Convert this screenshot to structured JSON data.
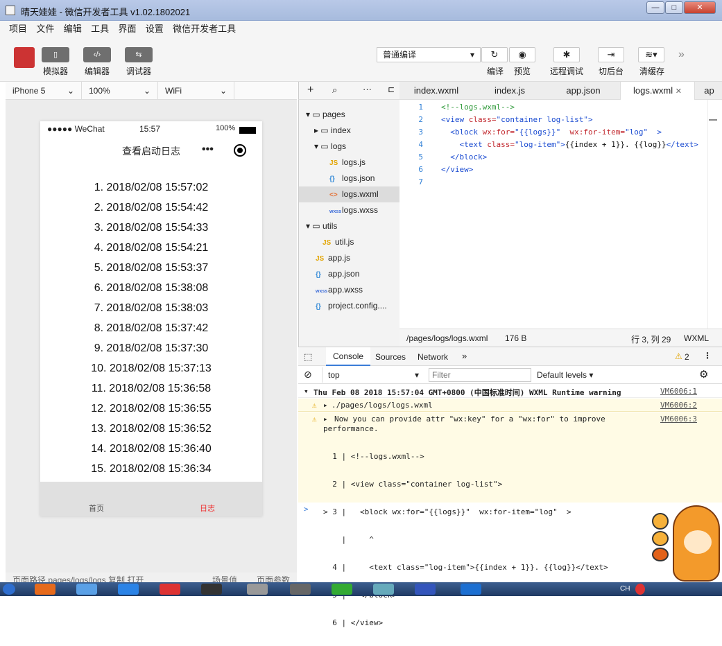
{
  "window": {
    "title": "晴天娃娃 - 微信开发者工具 v1.02.1802021",
    "btn_min": "—",
    "btn_max": "□",
    "btn_close": "✕"
  },
  "menu": [
    "项目",
    "文件",
    "编辑",
    "工具",
    "界面",
    "设置",
    "微信开发者工具"
  ],
  "toolbar": {
    "simulator": "模拟器",
    "editor": "编辑器",
    "debugger": "调试器",
    "compile_mode": "普通编译",
    "compile": "编译",
    "preview": "预览",
    "remote_debug": "远程调试",
    "background": "切后台",
    "clear_cache": "清缓存"
  },
  "simulator": {
    "device": "iPhone 5",
    "zoom": "100%",
    "network": "WiFi",
    "status_left": "●●●●● WeChat",
    "status_time": "15:57",
    "status_battery": "100%",
    "nav_title": "查看启动日志",
    "logs": [
      "1. 2018/02/08 15:57:02",
      "2. 2018/02/08 15:54:42",
      "3. 2018/02/08 15:54:33",
      "4. 2018/02/08 15:54:21",
      "5. 2018/02/08 15:53:37",
      "6. 2018/02/08 15:38:08",
      "7. 2018/02/08 15:38:03",
      "8. 2018/02/08 15:37:42",
      "9. 2018/02/08 15:37:30",
      "10. 2018/02/08 15:37:13",
      "11. 2018/02/08 15:36:58",
      "12. 2018/02/08 15:36:55",
      "13. 2018/02/08 15:36:52",
      "14. 2018/02/08 15:36:40",
      "15. 2018/02/08 15:36:34"
    ],
    "tab_home": "首页",
    "tab_logs": "日志",
    "bottom_left": "页面路径   pages/logs/logs  复制  打开",
    "bottom_mid": "场景值",
    "bottom_right": "页面参数"
  },
  "tree": {
    "pages": "pages",
    "index": "index",
    "logs": "logs",
    "logs_js": "logs.js",
    "logs_json": "logs.json",
    "logs_wxml": "logs.wxml",
    "logs_wxss": "logs.wxss",
    "utils": "utils",
    "util_js": "util.js",
    "app_js": "app.js",
    "app_json": "app.json",
    "app_wxss": "app.wxss",
    "project_config": "project.config...."
  },
  "editor": {
    "tabs": [
      "index.wxml",
      "index.js",
      "app.json",
      "logs.wxml",
      "ap"
    ],
    "active_tab": "logs.wxml",
    "lines": [
      "1",
      "2",
      "3",
      "4",
      "5",
      "6",
      "7"
    ],
    "status_path": "/pages/logs/logs.wxml",
    "status_size": "176 B",
    "status_pos": "行 3, 列 29",
    "status_lang": "WXML"
  },
  "console": {
    "tabs": [
      "Console",
      "Sources",
      "Network"
    ],
    "warning_count": "2",
    "context": "top",
    "filter_placeholder": "Filter",
    "levels": "Default levels",
    "header": "Thu Feb 08 2018 15:57:04 GMT+0800 (中国标准时间) WXML Runtime warning",
    "vm1": "VM6006:1",
    "w1": "./pages/logs/logs.wxml",
    "vm2": "VM6006:2",
    "w2a": "Now you can provide attr \"wx:key\" for a \"wx:for\" to improve",
    "w2b": "performance.",
    "vm3": "VM6006:3",
    "snippet": [
      "  1 | <!--logs.wxml-->",
      "  2 | <view class=\"container log-list\">",
      "> 3 |   <block wx:for=\"{{logs}}\"  wx:for-item=\"log\"  >",
      "    |     ^",
      "  4 |     <text class=\"log-item\">{{index + 1}}. {{log}}</text>",
      "  5 |   </block>",
      "  6 | </view>"
    ],
    "prompt": ">"
  },
  "taskbar": {
    "lang": "CH"
  }
}
